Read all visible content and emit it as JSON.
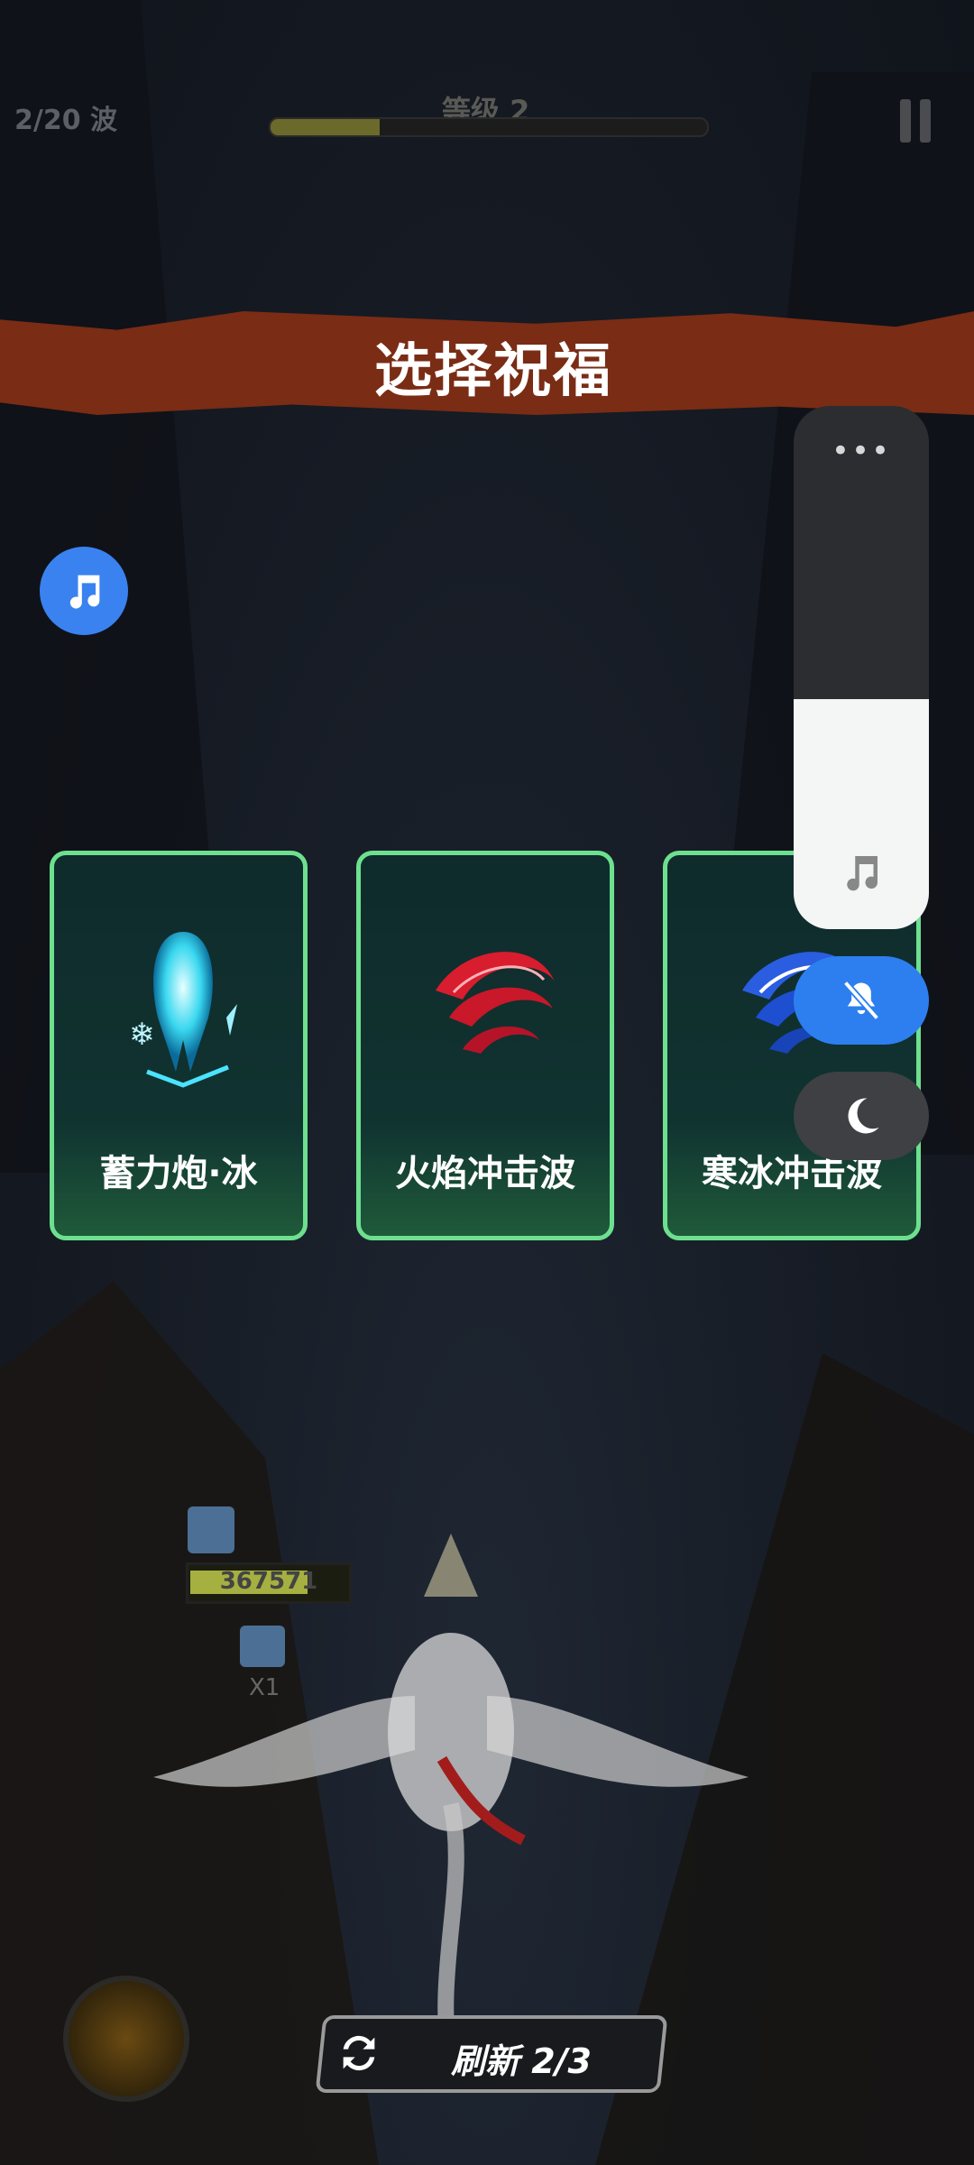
{
  "hud": {
    "wave": "2/20 波",
    "level": "等级 2",
    "level_progress": 0.25
  },
  "banner": {
    "title": "选择祝福"
  },
  "cards": [
    {
      "label": "蓄力炮·冰",
      "icon": "ice-cannon-icon"
    },
    {
      "label": "火焰冲击波",
      "icon": "fire-wave-icon"
    },
    {
      "label": "寒冰冲击波",
      "icon": "ice-wave-icon"
    }
  ],
  "side_panel": {
    "more": "•••",
    "volume_level": 0.44
  },
  "player": {
    "hp": "367571",
    "multiplier": "X1"
  },
  "refresh": {
    "label": "刷新 2/3"
  },
  "colors": {
    "banner": "#7a2c14",
    "card_border": "#6de08f",
    "accent_blue": "#2d7ff0"
  }
}
